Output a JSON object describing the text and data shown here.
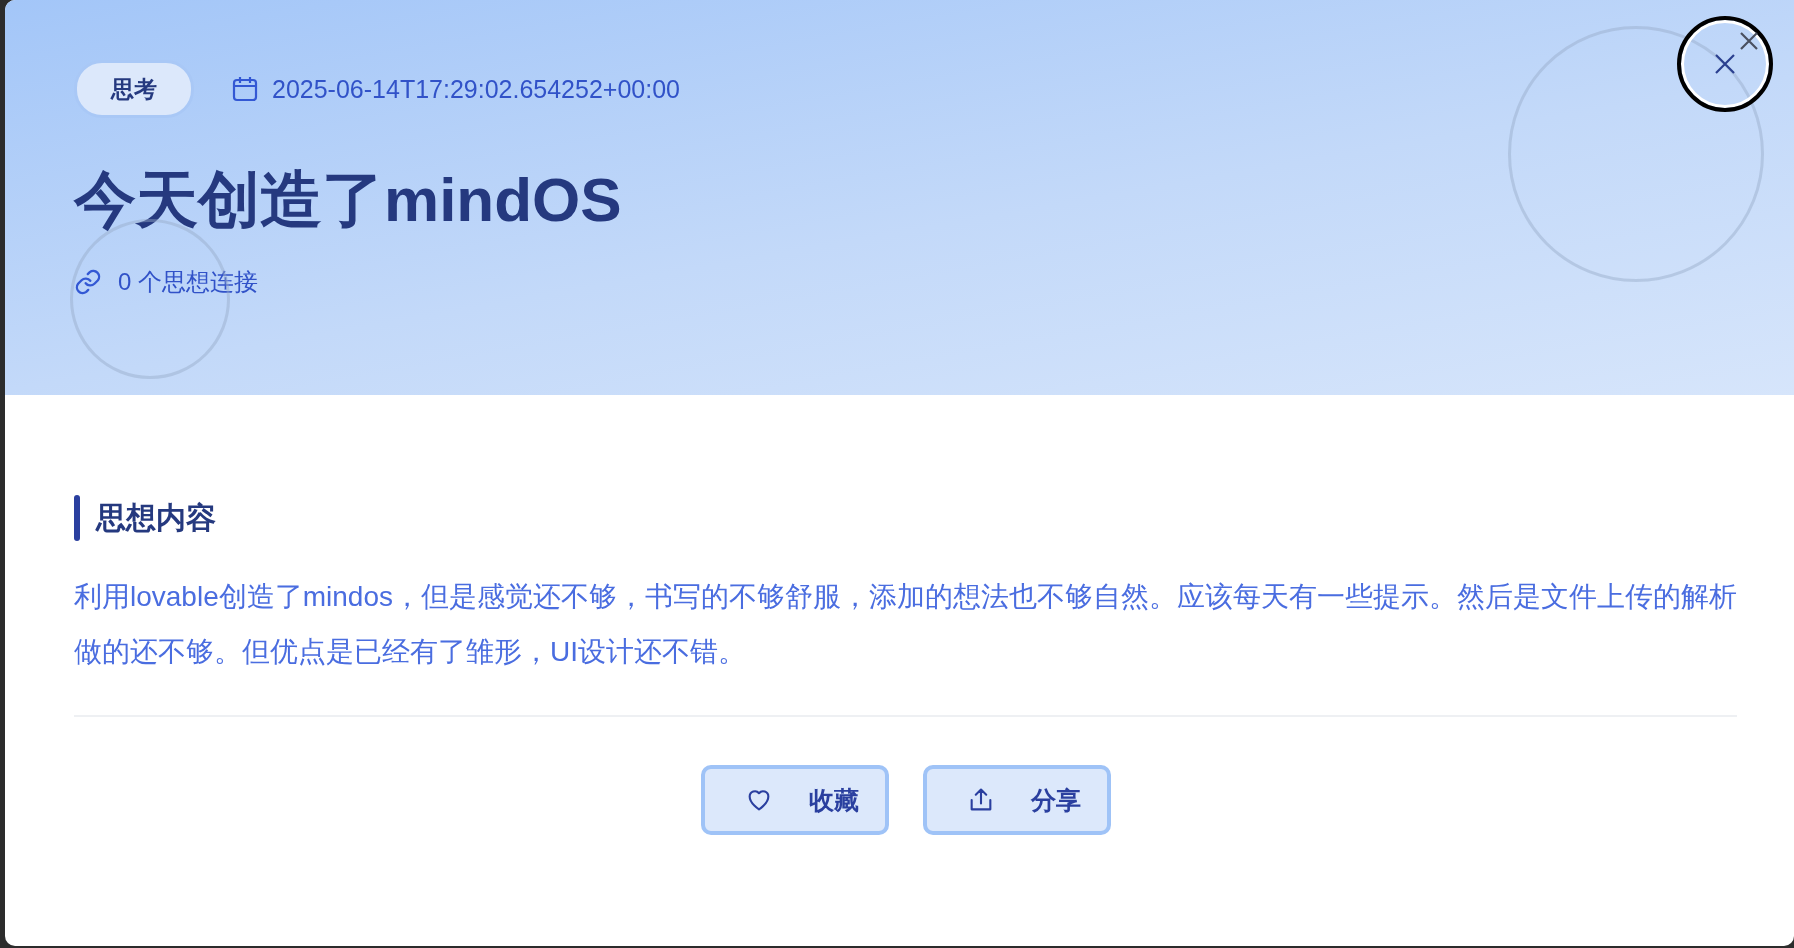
{
  "tag": {
    "label": "思考"
  },
  "timestamp": "2025-06-14T17:29:02.654252+00:00",
  "title": "今天创造了mindOS",
  "connections": "0 个思想连接",
  "section": {
    "heading": "思想内容",
    "body": "利用lovable创造了mindos，但是感觉还不够，书写的不够舒服，添加的想法也不够自然。应该每天有一些提示。然后是文件上传的解析做的还不够。但优点是已经有了雏形，UI设计还不错。"
  },
  "buttons": [
    {
      "label": "收藏",
      "kind": "heart"
    },
    {
      "label": "分享",
      "kind": "share"
    }
  ]
}
